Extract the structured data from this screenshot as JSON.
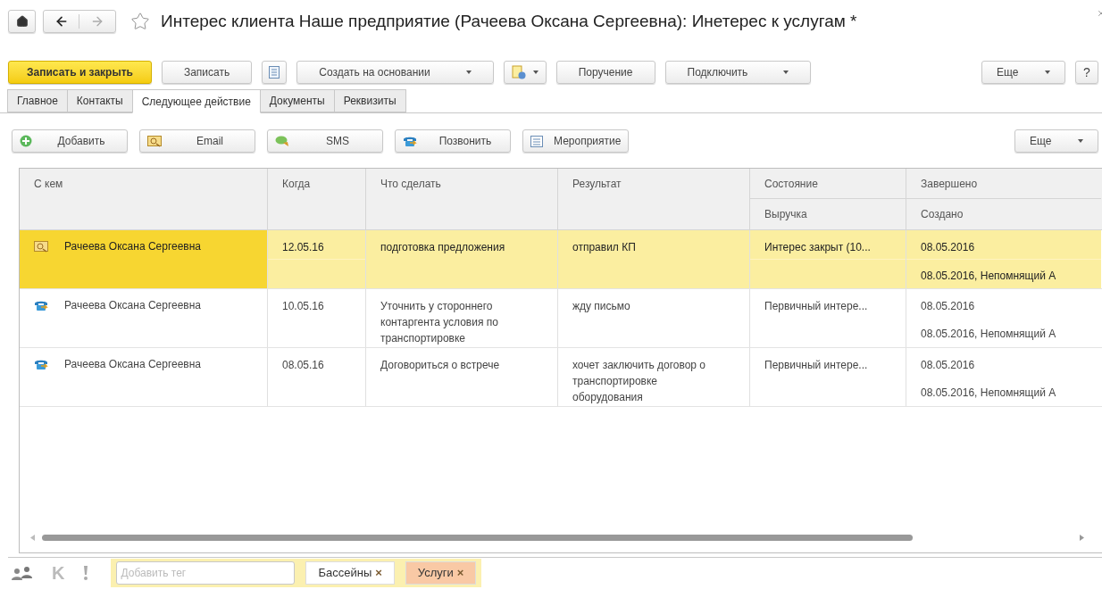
{
  "window": {
    "title": "Интерес клиента Наше предприятие (Рачеева Оксана Сергеевна): Инетерес к услугам *"
  },
  "toolbar": [
    {
      "kind": "primary",
      "label": "Записать и закрыть"
    },
    {
      "kind": "text",
      "label": "Записать"
    },
    {
      "kind": "icon"
    },
    {
      "kind": "dropdown",
      "label": "Создать на основании"
    },
    {
      "kind": "icon-dropdown"
    },
    {
      "kind": "text",
      "label": "Поручение"
    },
    {
      "kind": "dropdown",
      "label": "Подключить"
    }
  ],
  "toolbar_right": {
    "more": "Еще",
    "help": "?"
  },
  "tabs": [
    {
      "label": "Главное",
      "selected": false
    },
    {
      "label": "Контакты",
      "selected": false
    },
    {
      "label": "Следующее действие",
      "selected": true
    },
    {
      "label": "Документы",
      "selected": false
    },
    {
      "label": "Реквизиты",
      "selected": false
    }
  ],
  "actions": [
    {
      "kind": "add",
      "label": "Добавить"
    },
    {
      "kind": "email",
      "label": "Email"
    },
    {
      "kind": "sms",
      "label": "SMS"
    },
    {
      "kind": "call",
      "label": "Позвонить"
    },
    {
      "kind": "event",
      "label": "Мероприятие"
    }
  ],
  "actions_more": "Еще",
  "table": {
    "columns": [
      "С кем",
      "Когда",
      "Что сделать",
      "Результат",
      "Состояние",
      "Завершено"
    ],
    "subcolumns": {
      "state": "Выручка",
      "completed": "Создано"
    },
    "rows": [
      {
        "kind": "email",
        "selected": true,
        "who": "Рачеева Оксана Сергеевна",
        "when": "12.05.16",
        "what": "подготовка предложения",
        "result": "отправил КП",
        "state": "Интерес закрыт (10...",
        "completed": "08.05.2016",
        "created": "08.05.2016, Непомнящий А"
      },
      {
        "kind": "call",
        "selected": false,
        "who": "Рачеева Оксана Сергеевна",
        "when": "10.05.16",
        "what": "Уточнить у стороннего контаргента условия по транспортировке",
        "result": "жду письмо",
        "state": "Первичный интере...",
        "completed": "08.05.2016",
        "created": "08.05.2016, Непомнящий А"
      },
      {
        "kind": "call",
        "selected": false,
        "who": "Рачеева Оксана Сергеевна",
        "when": "08.05.16",
        "what": "Договориться о встрече",
        "result": "хочет заключить договор о транспортировке оборудования",
        "state": "Первичный интере...",
        "completed": "08.05.2016",
        "created": "08.05.2016, Непомнящий А"
      }
    ]
  },
  "footer": {
    "k_label": "K",
    "tag_placeholder": "Добавить тег",
    "tags": [
      {
        "label": "Бассейны",
        "remove": "×",
        "color": "#ffffff"
      },
      {
        "label": "Услуги",
        "remove": "×",
        "color": "#f9c9a5"
      }
    ]
  }
}
